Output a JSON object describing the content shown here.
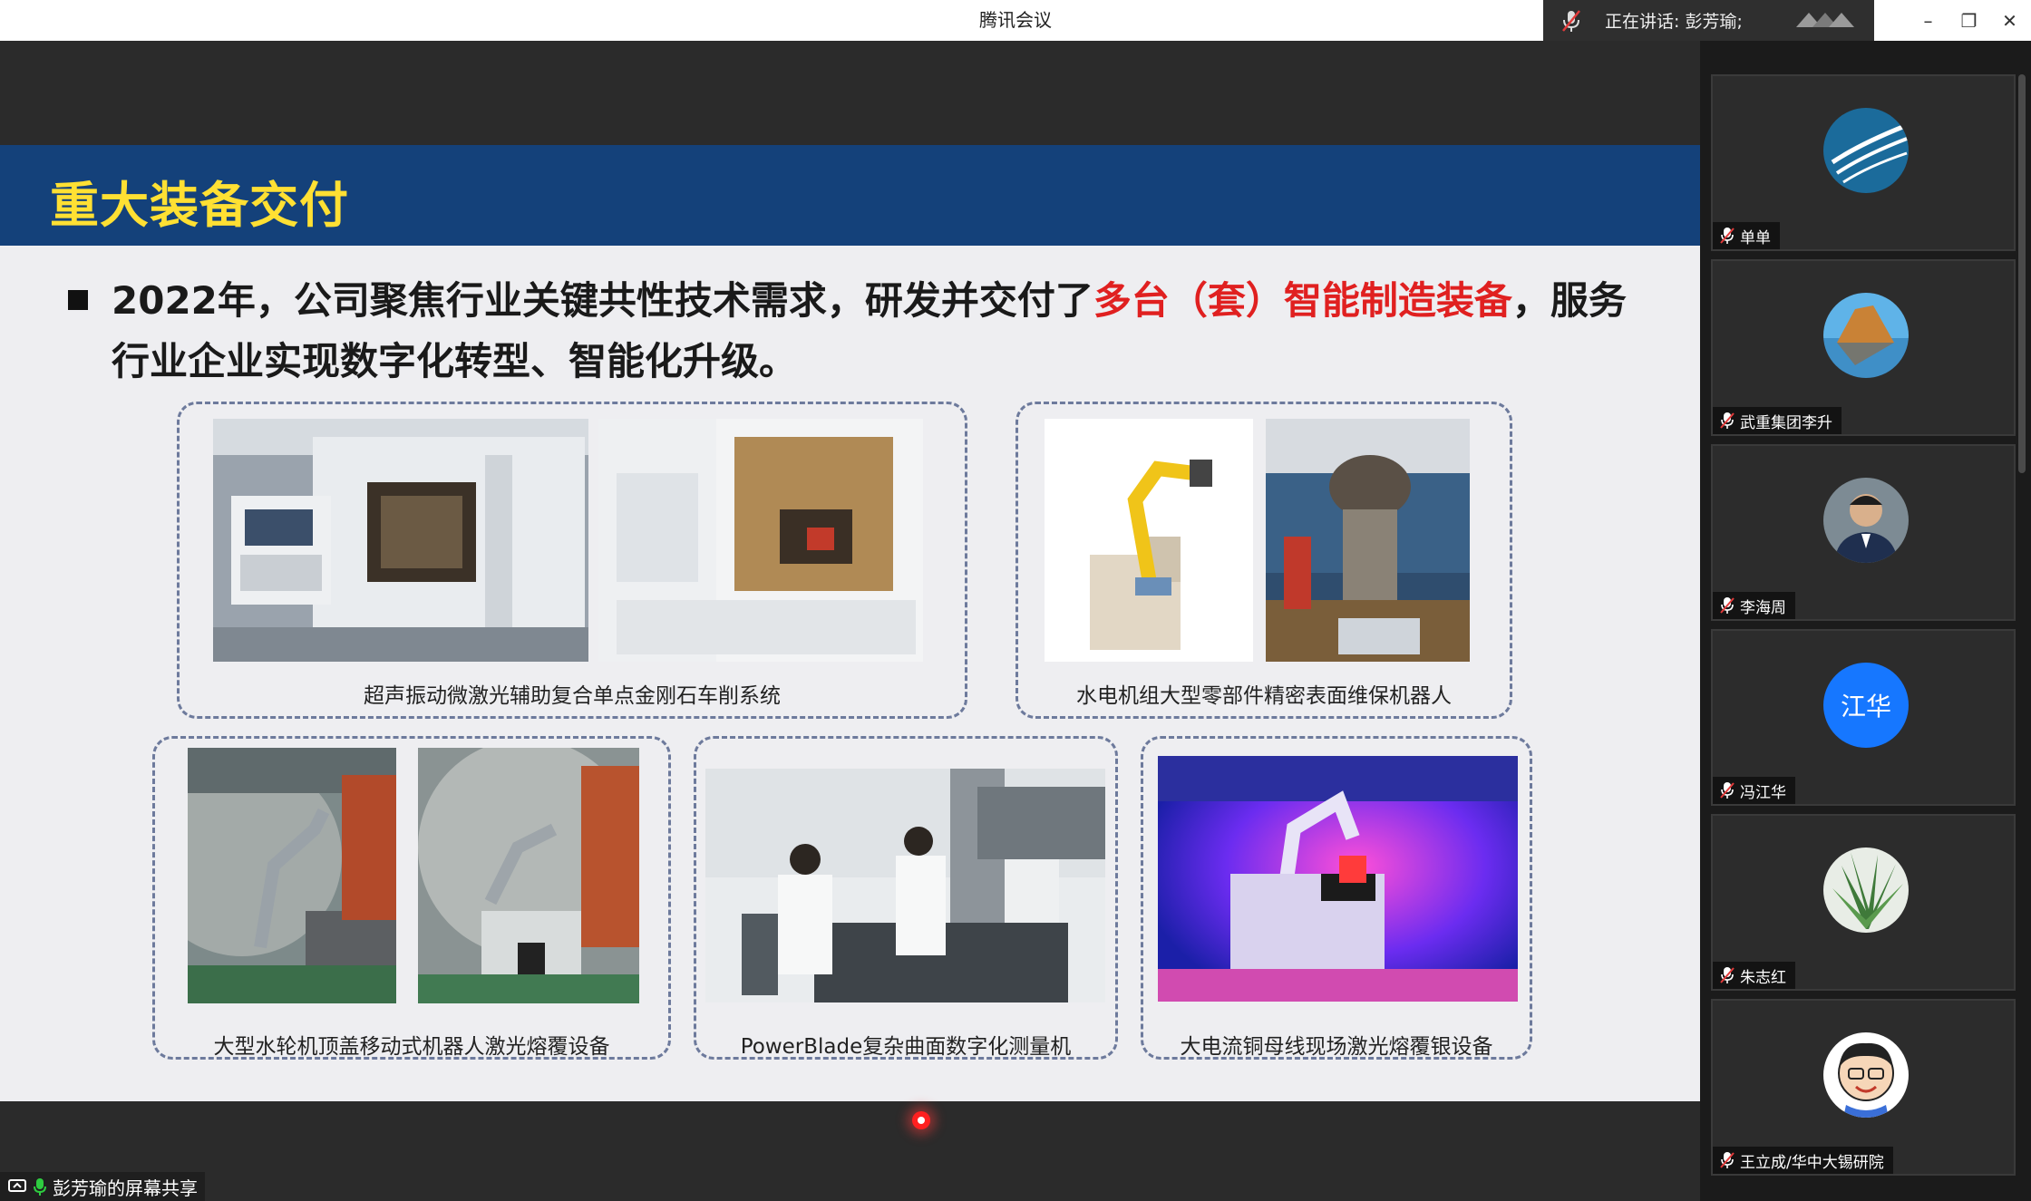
{
  "app": {
    "title": "腾讯会议",
    "speaking_text": "正在讲话: 彭芳瑜;",
    "window_controls": [
      "–",
      "❐",
      "✕"
    ]
  },
  "slide": {
    "title": "重大装备交付",
    "bullet_part1": "2022年，公司聚焦行业关键共性技术需求，研发并交付了",
    "bullet_highlight": "多台（套）智能制造装备",
    "bullet_part2": "，服务",
    "bullet_line2": "行业企业实现数字化转型、智能化升级。",
    "highlight_color": "#e02020",
    "title_color": "#ffe033",
    "header_color": "#14417a",
    "captions": [
      "超声振动微激光辅助复合单点金刚石车削系统",
      "水电机组大型零部件精密表面维保机器人",
      "大型水轮机顶盖移动式机器人激光熔覆设备",
      "PowerBlade复杂曲面数字化测量机",
      "大电流铜母线现场激光熔覆银设备"
    ]
  },
  "share_label": "彭芳瑜的屏幕共享",
  "participants": [
    {
      "name": "单单",
      "avatar": "blue-logo"
    },
    {
      "name": "武重集团李升",
      "avatar": "rock-landscape"
    },
    {
      "name": "李海周",
      "avatar": "man-portrait"
    },
    {
      "name": "冯江华",
      "avatar": "text",
      "avatar_text": "江华",
      "avatar_color": "#1677ff"
    },
    {
      "name": "朱志红",
      "avatar": "plant"
    },
    {
      "name": "王立成/华中大锡研院",
      "avatar": "cartoon"
    }
  ]
}
